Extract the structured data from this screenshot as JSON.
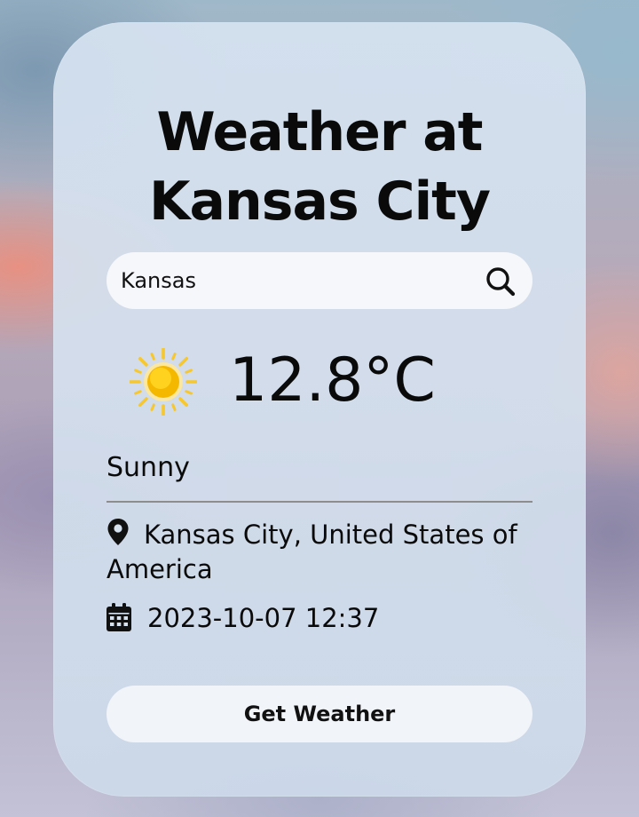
{
  "title": {
    "line1": "Weather at",
    "line2": "Kansas City"
  },
  "search": {
    "value": "Kansas",
    "icon": "search-icon"
  },
  "current": {
    "icon": "sun-icon",
    "temperature": "12.8°C",
    "condition": "Sunny"
  },
  "details": {
    "location_icon": "map-pin-icon",
    "location": "Kansas City, United States of America",
    "datetime_icon": "calendar-icon",
    "datetime": "2023-10-07 12:37"
  },
  "actions": {
    "get_weather_label": "Get Weather"
  },
  "colors": {
    "sun_core": "#F5B800",
    "sun_rays": "#F7C72B",
    "text": "#0A0A0A"
  }
}
